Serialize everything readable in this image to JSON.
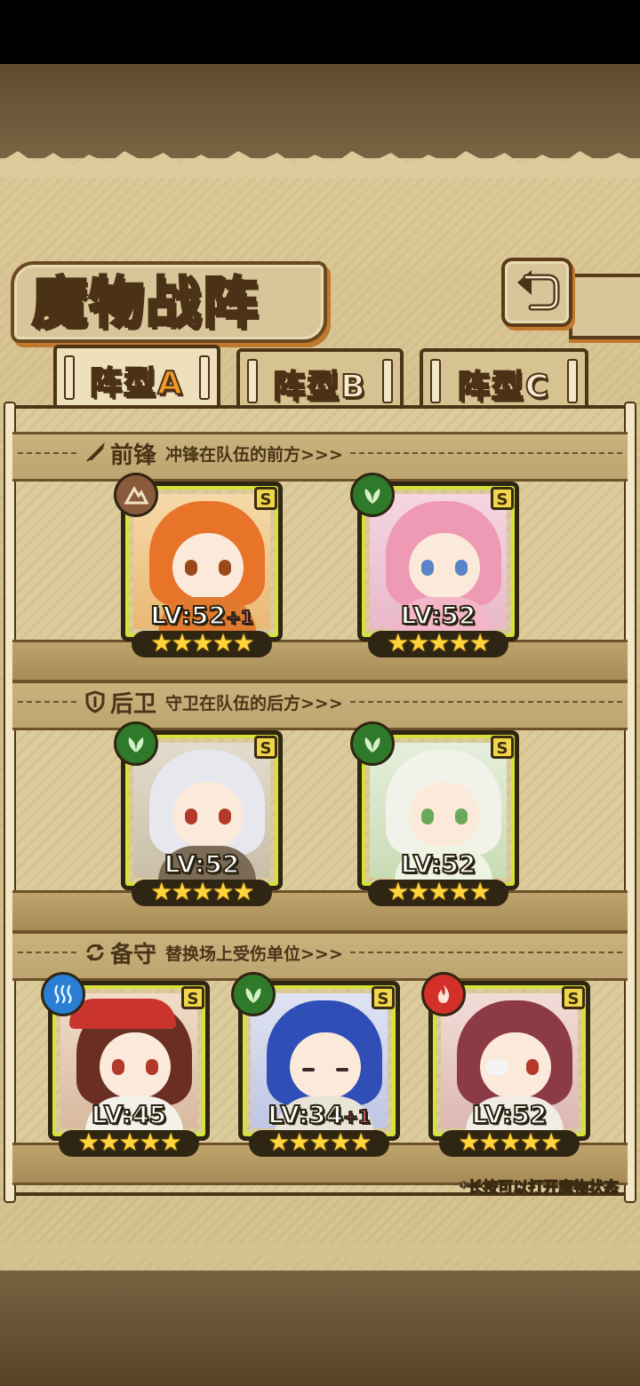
{
  "header": {
    "title": "魔物战阵",
    "back_icon": "return-arrow-icon"
  },
  "tabs": [
    {
      "prefix": "阵型",
      "suffix": "A",
      "active": true
    },
    {
      "prefix": "阵型",
      "suffix": "B",
      "active": false
    },
    {
      "prefix": "阵型",
      "suffix": "C",
      "active": false
    }
  ],
  "sections": {
    "front": {
      "title": "前锋",
      "desc": "冲锋在队伍的前方>>>",
      "icon": "sword-icon"
    },
    "rear": {
      "title": "后卫",
      "desc": "守卫在队伍的后方>>>",
      "icon": "shield-icon"
    },
    "reserve": {
      "title": "备守",
      "desc": "替换场上受伤单位>>>",
      "icon": "swap-cycle-icon"
    }
  },
  "colors": {
    "earth": "#8a5a3c",
    "nature": "#2f7a2a",
    "water": "#2a7fd4",
    "fire": "#d4302a",
    "frame_glow": "#d6e23a",
    "star": "#ffd43a"
  },
  "units": {
    "front_1": {
      "element": "earth-element-icon",
      "rank": "S",
      "level": "LV:52",
      "bonus": "+1",
      "stars": "★★★★★"
    },
    "front_2": {
      "element": "leaf-element-icon",
      "rank": "S",
      "level": "LV:52",
      "bonus": "",
      "stars": "★★★★★"
    },
    "rear_1": {
      "element": "leaf-element-icon",
      "rank": "S",
      "level": "LV:52",
      "bonus": "",
      "stars": "★★★★★"
    },
    "rear_2": {
      "element": "leaf-element-icon",
      "rank": "S",
      "level": "LV:52",
      "bonus": "",
      "stars": "★★★★★"
    },
    "reserve_1": {
      "element": "water-element-icon",
      "rank": "S",
      "level": "LV:45",
      "bonus": "",
      "stars": "★★★★★"
    },
    "reserve_2": {
      "element": "leaf-element-icon",
      "rank": "S",
      "level": "LV:34",
      "bonus": "+1",
      "stars": "★★★★★"
    },
    "reserve_3": {
      "element": "fire-element-icon",
      "rank": "S",
      "level": "LV:52",
      "bonus": "",
      "stars": "★★★★★"
    }
  },
  "footnote": "*长按可以打开魔物状态"
}
